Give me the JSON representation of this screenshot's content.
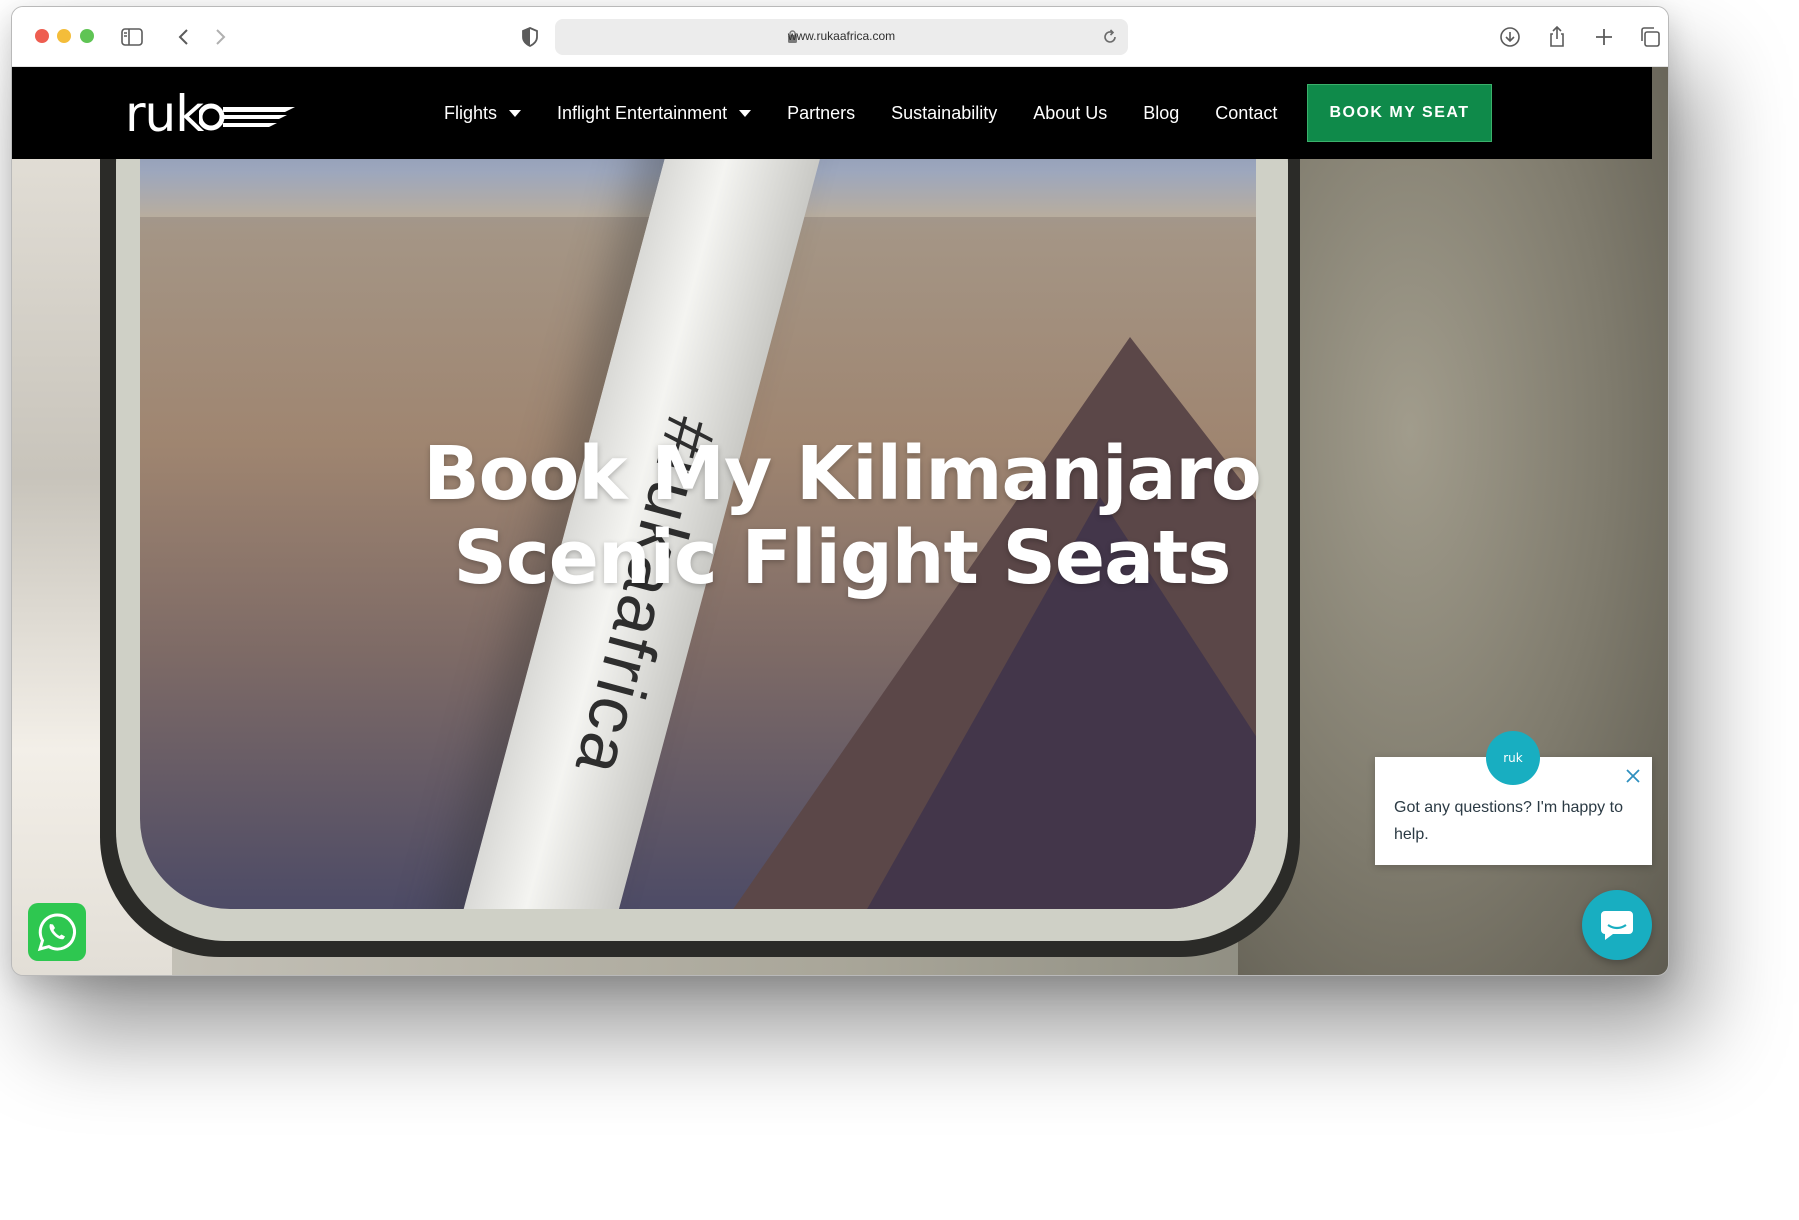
{
  "browser": {
    "url": "www.rukaafrica.com",
    "icons": [
      "sidebar-icon",
      "back-icon",
      "forward-icon",
      "shield-icon",
      "lock-icon",
      "reload-icon",
      "download-icon",
      "share-icon",
      "new-tab-icon",
      "tabs-overview-icon"
    ]
  },
  "site": {
    "logo_text": "ruk",
    "nav": [
      {
        "label": "Flights",
        "dropdown": true
      },
      {
        "label": "Inflight Entertainment",
        "dropdown": true
      },
      {
        "label": "Partners",
        "dropdown": false
      },
      {
        "label": "Sustainability",
        "dropdown": false
      },
      {
        "label": "About Us",
        "dropdown": false
      },
      {
        "label": "Blog",
        "dropdown": false
      },
      {
        "label": "Contact",
        "dropdown": false
      }
    ],
    "cta_label": "BOOK MY SEAT",
    "hero": {
      "line1": "Book My Kilimanjaro",
      "line2": "Scenic Flight Seats",
      "strut_text": "#rukaafrica"
    },
    "chat": {
      "avatar_text": "ruk",
      "message": "Got any questions? I'm happy to help."
    },
    "colors": {
      "nav_bg": "#000000",
      "cta_bg": "#0f8a4a",
      "chat_accent": "#18aec1",
      "whatsapp": "#2ec750"
    }
  }
}
